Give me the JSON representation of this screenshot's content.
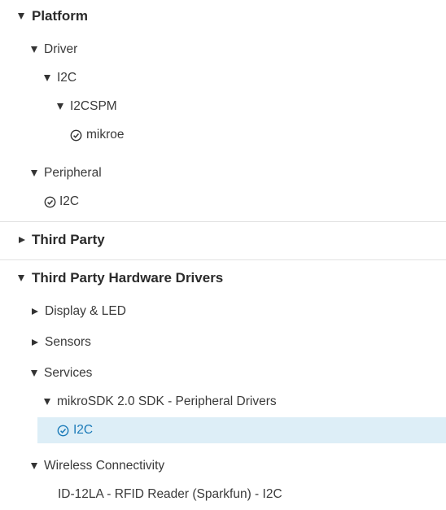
{
  "tree": {
    "platform": {
      "label": "Platform",
      "driver": {
        "label": "Driver",
        "i2c": {
          "label": "I2C",
          "i2cspm": {
            "label": "I2CSPM",
            "mikroe": {
              "label": "mikroe"
            }
          }
        }
      },
      "peripheral": {
        "label": "Peripheral",
        "i2c": {
          "label": "I2C"
        }
      }
    },
    "third_party": {
      "label": "Third Party"
    },
    "third_party_hw": {
      "label": "Third Party Hardware Drivers",
      "display_led": {
        "label": "Display & LED"
      },
      "sensors": {
        "label": "Sensors"
      },
      "services": {
        "label": "Services",
        "mikrosdk": {
          "label": "mikroSDK 2.0 SDK - Peripheral Drivers",
          "i2c": {
            "label": "I2C"
          }
        }
      },
      "wireless": {
        "label": "Wireless Connectivity",
        "id12la": {
          "label": "ID-12LA - RFID Reader (Sparkfun) - I2C"
        }
      }
    }
  },
  "colors": {
    "selection_bg": "#ddeef7",
    "selection_text": "#1a7ab8",
    "text": "#333333"
  },
  "icons": {
    "expanded": "caret-down-icon",
    "collapsed": "caret-right-icon",
    "installed": "check-circle-icon"
  }
}
